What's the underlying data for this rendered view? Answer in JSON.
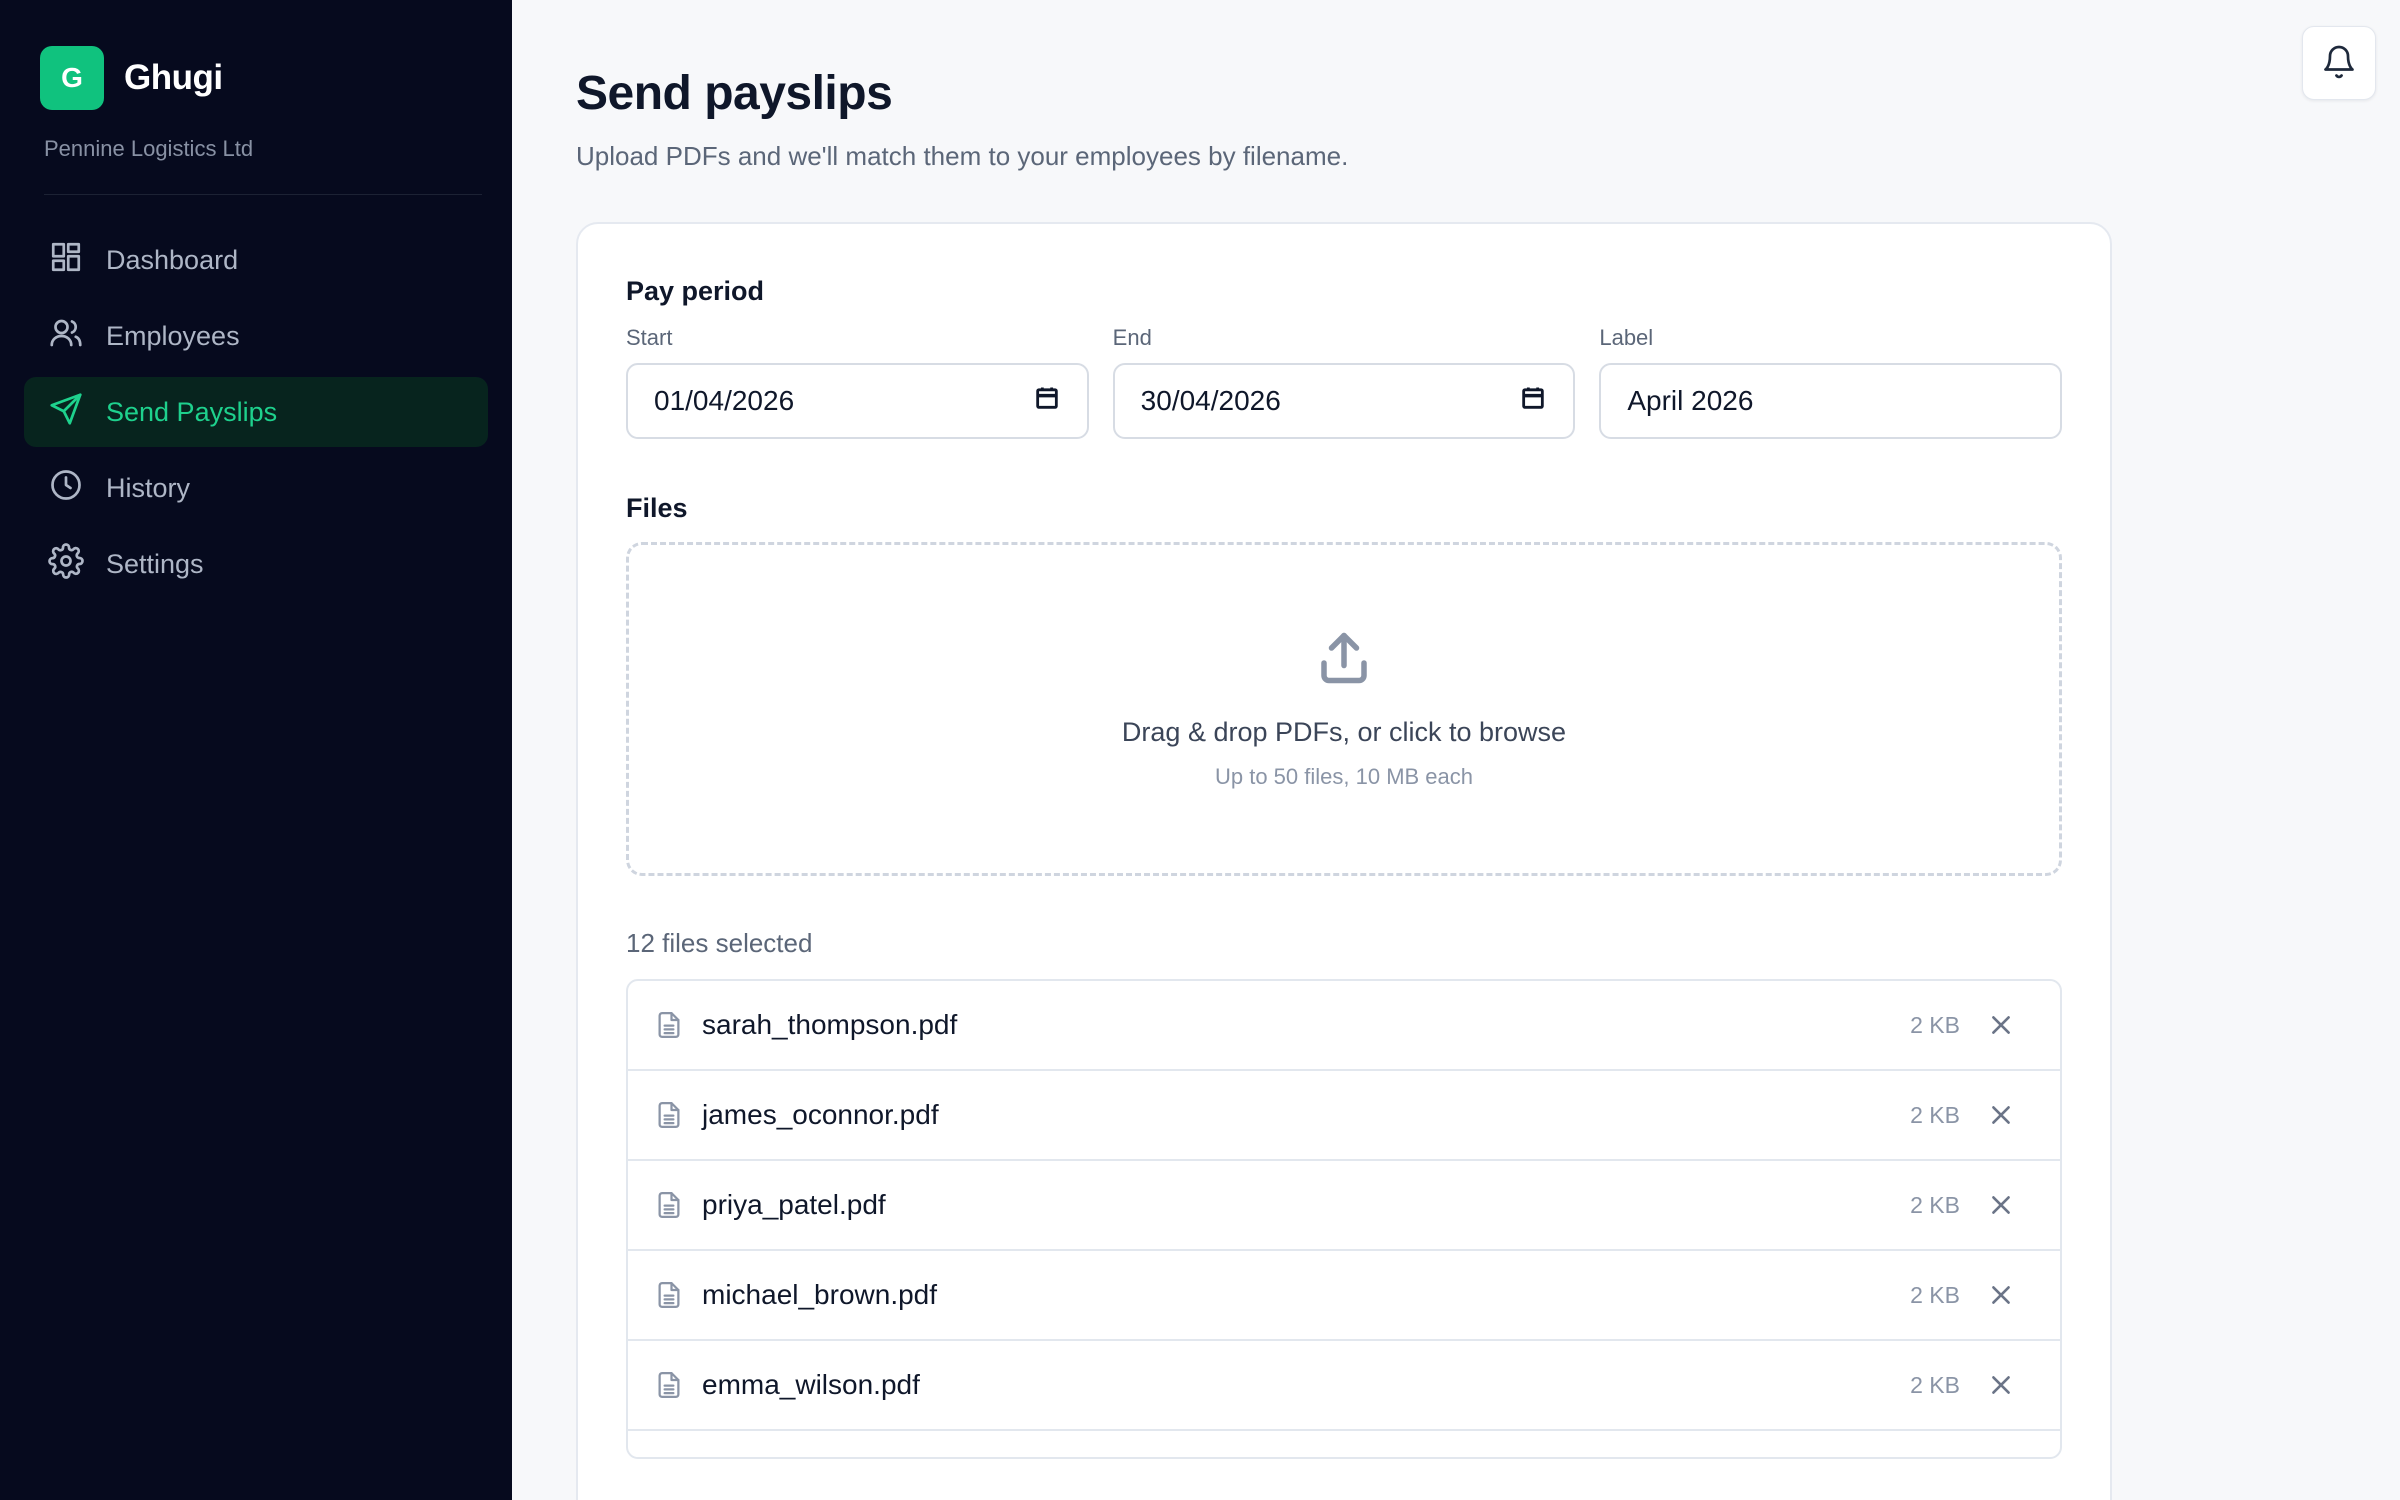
{
  "brand": {
    "logo_letter": "G",
    "name": "Ghugi",
    "org": "Pennine Logistics Ltd",
    "accent": "#10c27e"
  },
  "nav": {
    "items": [
      {
        "label": "Dashboard",
        "icon": "grid-icon"
      },
      {
        "label": "Employees",
        "icon": "users-icon"
      },
      {
        "label": "Send Payslips",
        "icon": "send-icon",
        "active": true
      },
      {
        "label": "History",
        "icon": "clock-icon"
      },
      {
        "label": "Settings",
        "icon": "gear-icon"
      }
    ]
  },
  "header": {
    "title": "Send payslips",
    "subtitle": "Upload PDFs and we'll match them to your employees by filename.",
    "notification_icon": "bell-icon"
  },
  "pay_period": {
    "section_label": "Pay period",
    "start_label": "Start",
    "start_value": "01/04/2026",
    "end_label": "End",
    "end_value": "30/04/2026",
    "label_label": "Label",
    "label_value": "April 2026"
  },
  "files": {
    "section_label": "Files",
    "dropzone_text": "Drag & drop PDFs, or click to browse",
    "dropzone_hint": "Up to 50 files, 10 MB each",
    "count_text": "12 files selected",
    "list": [
      {
        "name": "sarah_thompson.pdf",
        "size": "2 KB"
      },
      {
        "name": "james_oconnor.pdf",
        "size": "2 KB"
      },
      {
        "name": "priya_patel.pdf",
        "size": "2 KB"
      },
      {
        "name": "michael_brown.pdf",
        "size": "2 KB"
      },
      {
        "name": "emma_wilson.pdf",
        "size": "2 KB"
      }
    ]
  }
}
